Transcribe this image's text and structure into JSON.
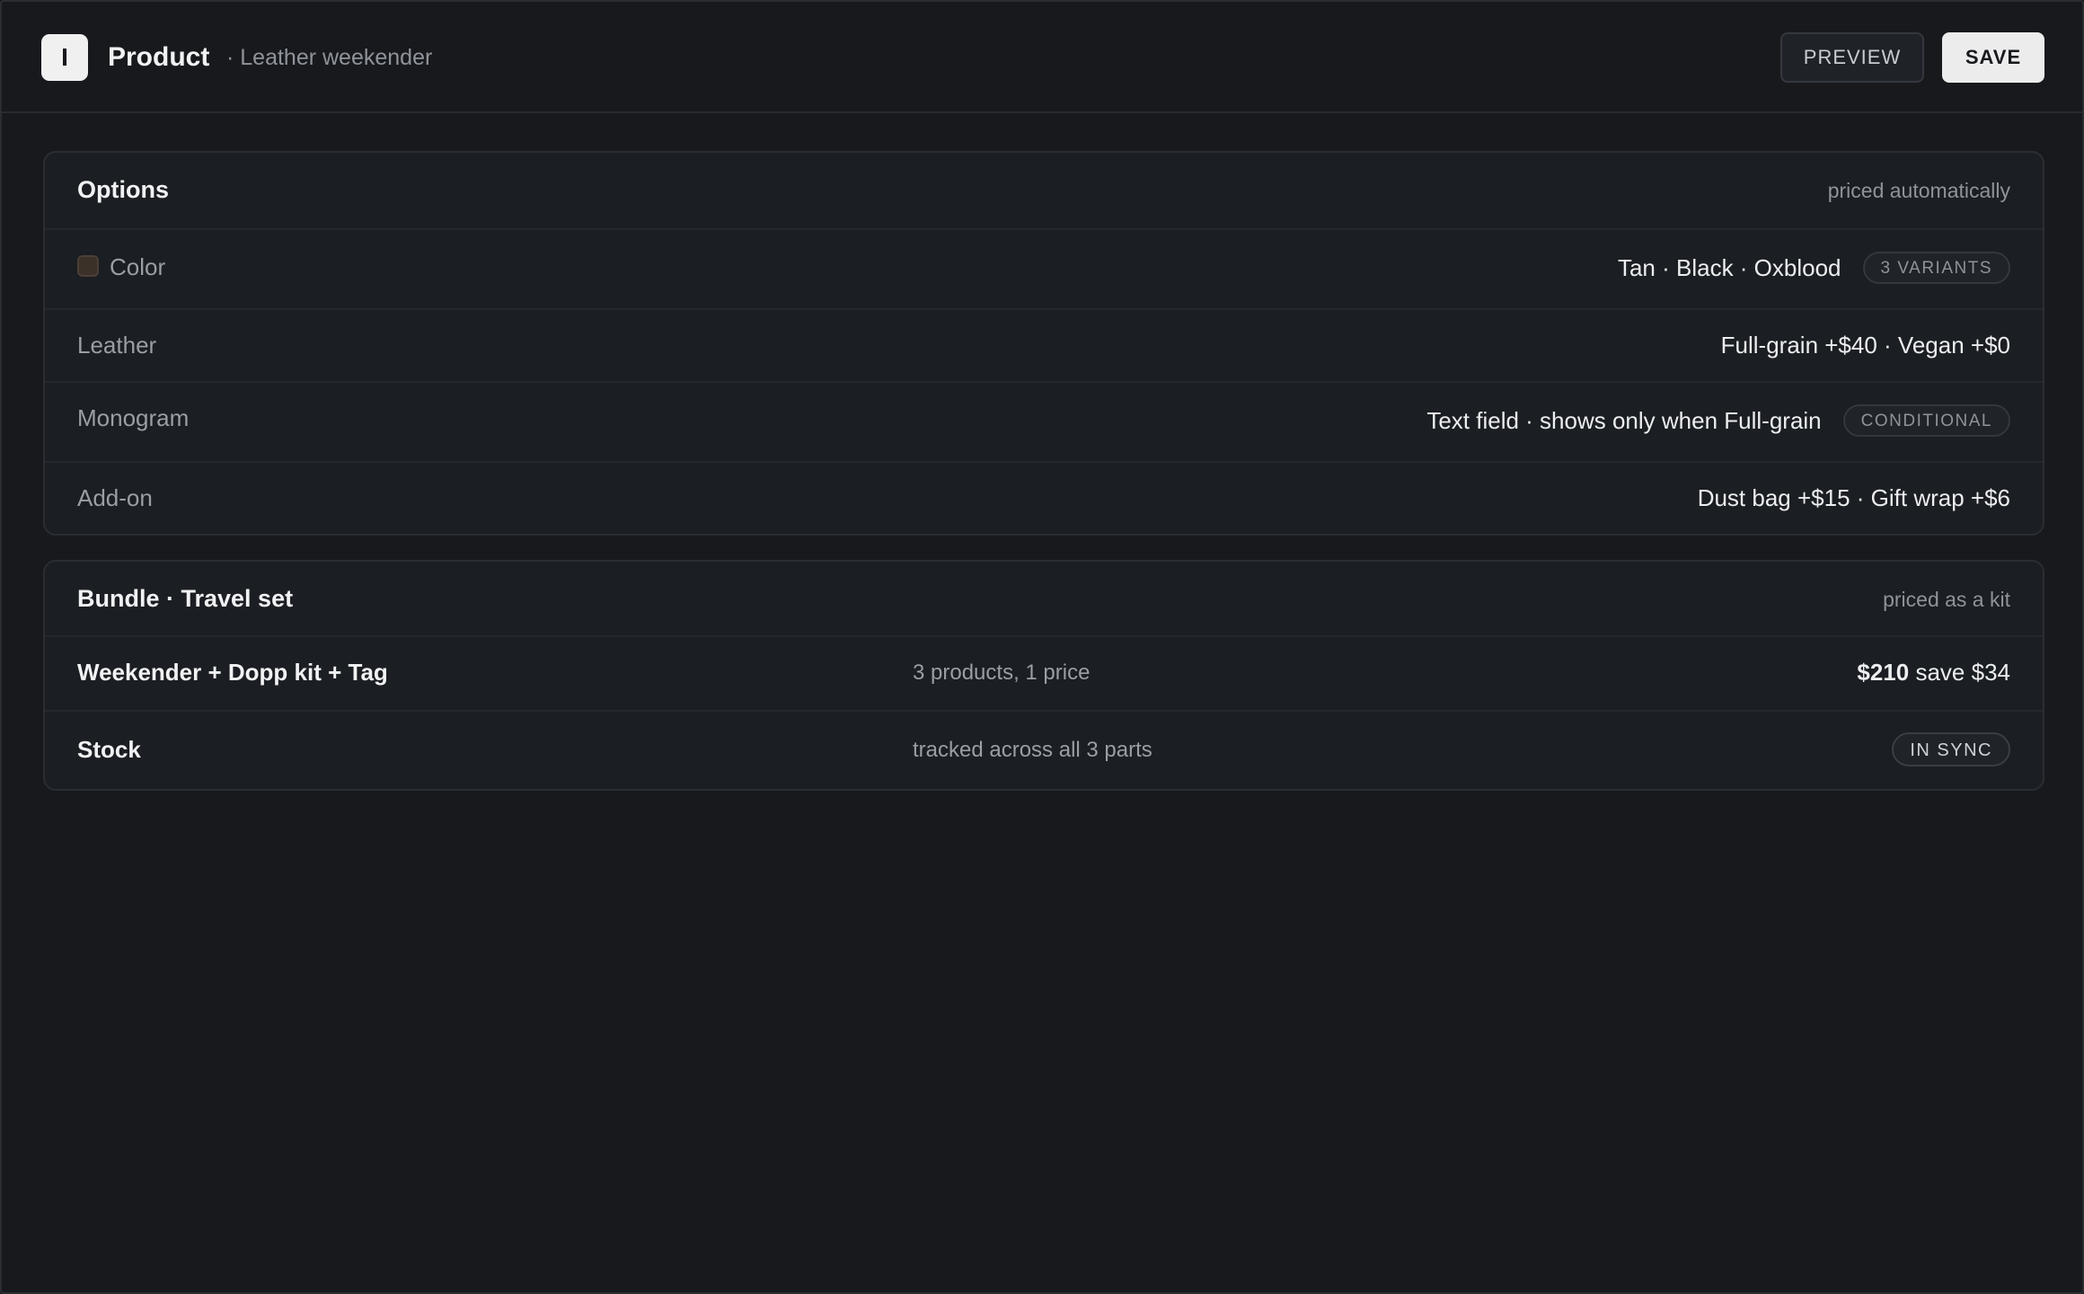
{
  "header": {
    "logo_letter": "I",
    "title": "Product",
    "subtitle": "· Leather weekender",
    "preview_label": "PREVIEW",
    "save_label": "SAVE"
  },
  "options": {
    "title": "Options",
    "note": "priced automatically",
    "rows": [
      {
        "label": "Color",
        "value": "Tan · Black · Oxblood",
        "badge": "3 VARIANTS",
        "swatch_color": "#3b3128"
      },
      {
        "label": "Leather",
        "value": "Full-grain +$40 · Vegan +$0"
      },
      {
        "label": "Monogram",
        "value": "Text field · shows only when Full-grain",
        "badge": "CONDITIONAL"
      },
      {
        "label": "Add-on",
        "value": "Dust bag +$15 · Gift wrap +$6"
      }
    ]
  },
  "bundle": {
    "title": "Bundle · Travel set",
    "note": "priced as a kit",
    "kit": {
      "label": "Weekender + Dopp kit + Tag",
      "description": "3 products, 1 price",
      "price": "$210",
      "savings": "save $34"
    },
    "stock": {
      "label": "Stock",
      "description": "tracked across all 3 parts",
      "status": "IN SYNC"
    }
  },
  "colors": {
    "background": "#17191d",
    "card": "#1b1e22",
    "save_button": "#ececed"
  }
}
